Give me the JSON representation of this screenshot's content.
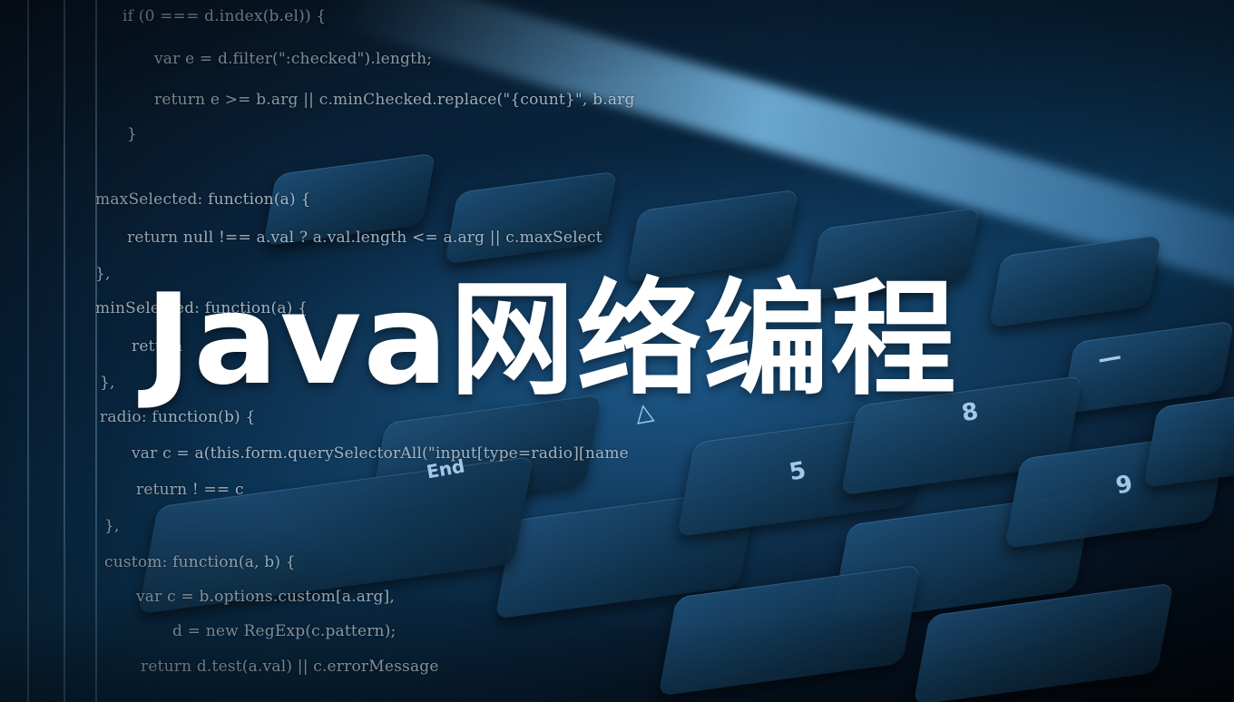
{
  "title": "Java网络编程",
  "colors": {
    "background_dark": "#040a14",
    "keyboard_blue": "#1f4f78",
    "glow_blue": "#8cd2ff",
    "title_text": "#ffffff"
  },
  "code_lines": [
    "if (0 === d.index(b.el)) {",
    "var e = d.filter(\":checked\").length;",
    "return e >= b.arg || c.minChecked.replace(\"{count}\", b.arg",
    "}",
    "maxSelected: function(a) {",
    "return null !== a.val ? a.val.length <= a.arg || c.maxSelect",
    "},",
    "minSelected: function(a) {",
    "return",
    "},",
    "radio: function(b) {",
    "var c = a(this.form.querySelectorAll(\"input[type=radio][name",
    "return ! == c",
    "},",
    "custom: function(a, b) {",
    "var c = b.options.custom[a.arg],",
    "d = new RegExp(c.pattern);",
    "return d.test(a.val) || c.errorMessage"
  ],
  "key_glyphs": [
    "5",
    "8",
    "9",
    "—",
    "End",
    "△"
  ]
}
